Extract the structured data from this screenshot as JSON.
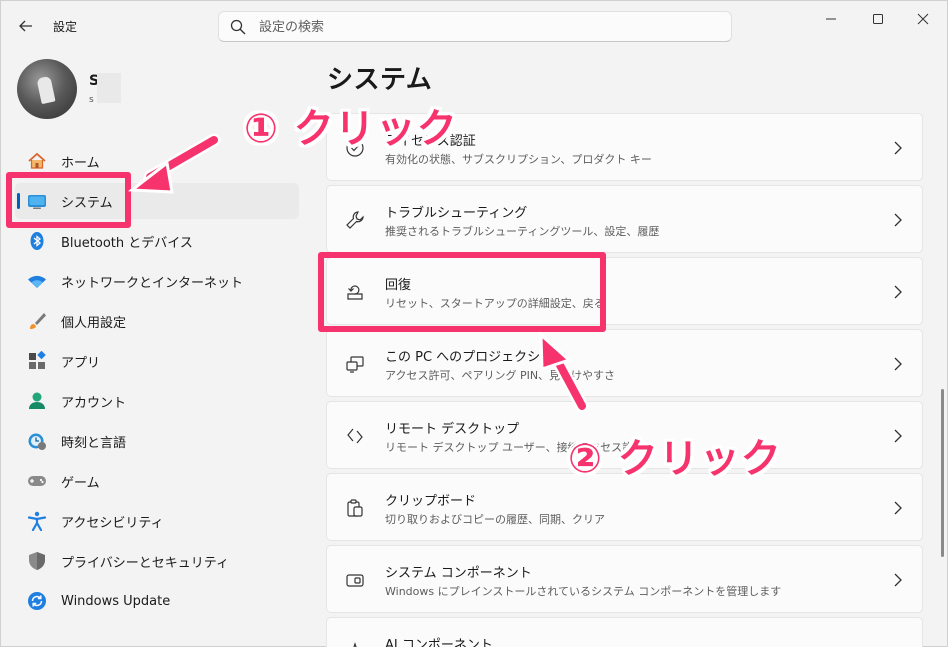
{
  "window": {
    "title": "設定"
  },
  "search": {
    "placeholder": "設定の検索"
  },
  "profile": {
    "name": "S",
    "subtitle": "s"
  },
  "sidebar": {
    "items": [
      {
        "label": "ホーム",
        "icon": "home-icon"
      },
      {
        "label": "システム",
        "icon": "system-icon",
        "active": true
      },
      {
        "label": "Bluetooth とデバイス",
        "icon": "bluetooth-icon"
      },
      {
        "label": "ネットワークとインターネット",
        "icon": "wifi-icon"
      },
      {
        "label": "個人用設定",
        "icon": "brush-icon"
      },
      {
        "label": "アプリ",
        "icon": "apps-icon"
      },
      {
        "label": "アカウント",
        "icon": "account-icon"
      },
      {
        "label": "時刻と言語",
        "icon": "clock-globe-icon"
      },
      {
        "label": "ゲーム",
        "icon": "gamepad-icon"
      },
      {
        "label": "アクセシビリティ",
        "icon": "accessibility-icon"
      },
      {
        "label": "プライバシーとセキュリティ",
        "icon": "shield-icon"
      },
      {
        "label": "Windows Update",
        "icon": "update-icon"
      }
    ]
  },
  "main": {
    "title": "システム",
    "cards": [
      {
        "title": "ライセンス認証",
        "description": "有効化の状態、サブスクリプション、プロダクト キー",
        "icon": "activation-check-icon"
      },
      {
        "title": "トラブルシューティング",
        "description": "推奨されるトラブルシューティングツール、設定、履歴",
        "icon": "wrench-icon"
      },
      {
        "title": "回復",
        "description": "リセット、スタートアップの詳細設定、戻る",
        "icon": "recovery-icon"
      },
      {
        "title": "この PC へのプロジェクション",
        "description": "アクセス許可、ペアリング PIN、見つけやすさ",
        "icon": "projection-icon"
      },
      {
        "title": "リモート デスクトップ",
        "description": "リモート デスクトップ ユーザー、接続アクセス許可",
        "icon": "remote-desktop-icon"
      },
      {
        "title": "クリップボード",
        "description": "切り取りおよびコピーの履歴、同期、クリア",
        "icon": "clipboard-icon"
      },
      {
        "title": "システム コンポーネント",
        "description": "Windows にプレインストールされているシステム コンポーネントを管理します",
        "icon": "component-icon"
      },
      {
        "title": "AI コンポーネント",
        "description": "",
        "icon": "ai-icon"
      }
    ]
  },
  "annotations": {
    "step1": "① クリック",
    "step2": "② クリック",
    "color": "#f7336d"
  },
  "colors": {
    "accent": "#005fb8",
    "background": "#f3f3f3",
    "card": "#fbfbfb"
  }
}
